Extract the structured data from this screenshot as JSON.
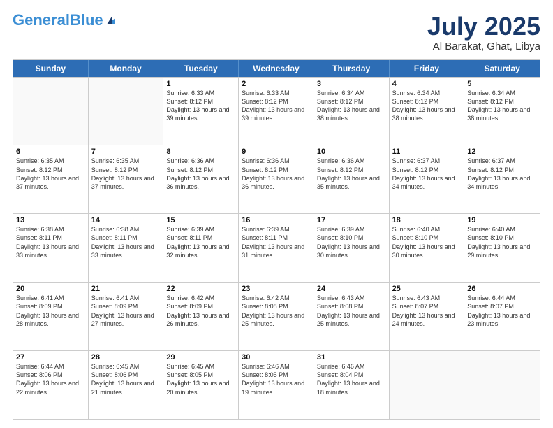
{
  "logo": {
    "part1": "General",
    "part2": "Blue"
  },
  "header": {
    "month": "July 2025",
    "location": "Al Barakat, Ghat, Libya"
  },
  "weekdays": [
    "Sunday",
    "Monday",
    "Tuesday",
    "Wednesday",
    "Thursday",
    "Friday",
    "Saturday"
  ],
  "weeks": [
    [
      {
        "day": "",
        "info": ""
      },
      {
        "day": "",
        "info": ""
      },
      {
        "day": "1",
        "info": "Sunrise: 6:33 AM\nSunset: 8:12 PM\nDaylight: 13 hours and 39 minutes."
      },
      {
        "day": "2",
        "info": "Sunrise: 6:33 AM\nSunset: 8:12 PM\nDaylight: 13 hours and 39 minutes."
      },
      {
        "day": "3",
        "info": "Sunrise: 6:34 AM\nSunset: 8:12 PM\nDaylight: 13 hours and 38 minutes."
      },
      {
        "day": "4",
        "info": "Sunrise: 6:34 AM\nSunset: 8:12 PM\nDaylight: 13 hours and 38 minutes."
      },
      {
        "day": "5",
        "info": "Sunrise: 6:34 AM\nSunset: 8:12 PM\nDaylight: 13 hours and 38 minutes."
      }
    ],
    [
      {
        "day": "6",
        "info": "Sunrise: 6:35 AM\nSunset: 8:12 PM\nDaylight: 13 hours and 37 minutes."
      },
      {
        "day": "7",
        "info": "Sunrise: 6:35 AM\nSunset: 8:12 PM\nDaylight: 13 hours and 37 minutes."
      },
      {
        "day": "8",
        "info": "Sunrise: 6:36 AM\nSunset: 8:12 PM\nDaylight: 13 hours and 36 minutes."
      },
      {
        "day": "9",
        "info": "Sunrise: 6:36 AM\nSunset: 8:12 PM\nDaylight: 13 hours and 36 minutes."
      },
      {
        "day": "10",
        "info": "Sunrise: 6:36 AM\nSunset: 8:12 PM\nDaylight: 13 hours and 35 minutes."
      },
      {
        "day": "11",
        "info": "Sunrise: 6:37 AM\nSunset: 8:12 PM\nDaylight: 13 hours and 34 minutes."
      },
      {
        "day": "12",
        "info": "Sunrise: 6:37 AM\nSunset: 8:12 PM\nDaylight: 13 hours and 34 minutes."
      }
    ],
    [
      {
        "day": "13",
        "info": "Sunrise: 6:38 AM\nSunset: 8:11 PM\nDaylight: 13 hours and 33 minutes."
      },
      {
        "day": "14",
        "info": "Sunrise: 6:38 AM\nSunset: 8:11 PM\nDaylight: 13 hours and 33 minutes."
      },
      {
        "day": "15",
        "info": "Sunrise: 6:39 AM\nSunset: 8:11 PM\nDaylight: 13 hours and 32 minutes."
      },
      {
        "day": "16",
        "info": "Sunrise: 6:39 AM\nSunset: 8:11 PM\nDaylight: 13 hours and 31 minutes."
      },
      {
        "day": "17",
        "info": "Sunrise: 6:39 AM\nSunset: 8:10 PM\nDaylight: 13 hours and 30 minutes."
      },
      {
        "day": "18",
        "info": "Sunrise: 6:40 AM\nSunset: 8:10 PM\nDaylight: 13 hours and 30 minutes."
      },
      {
        "day": "19",
        "info": "Sunrise: 6:40 AM\nSunset: 8:10 PM\nDaylight: 13 hours and 29 minutes."
      }
    ],
    [
      {
        "day": "20",
        "info": "Sunrise: 6:41 AM\nSunset: 8:09 PM\nDaylight: 13 hours and 28 minutes."
      },
      {
        "day": "21",
        "info": "Sunrise: 6:41 AM\nSunset: 8:09 PM\nDaylight: 13 hours and 27 minutes."
      },
      {
        "day": "22",
        "info": "Sunrise: 6:42 AM\nSunset: 8:09 PM\nDaylight: 13 hours and 26 minutes."
      },
      {
        "day": "23",
        "info": "Sunrise: 6:42 AM\nSunset: 8:08 PM\nDaylight: 13 hours and 25 minutes."
      },
      {
        "day": "24",
        "info": "Sunrise: 6:43 AM\nSunset: 8:08 PM\nDaylight: 13 hours and 25 minutes."
      },
      {
        "day": "25",
        "info": "Sunrise: 6:43 AM\nSunset: 8:07 PM\nDaylight: 13 hours and 24 minutes."
      },
      {
        "day": "26",
        "info": "Sunrise: 6:44 AM\nSunset: 8:07 PM\nDaylight: 13 hours and 23 minutes."
      }
    ],
    [
      {
        "day": "27",
        "info": "Sunrise: 6:44 AM\nSunset: 8:06 PM\nDaylight: 13 hours and 22 minutes."
      },
      {
        "day": "28",
        "info": "Sunrise: 6:45 AM\nSunset: 8:06 PM\nDaylight: 13 hours and 21 minutes."
      },
      {
        "day": "29",
        "info": "Sunrise: 6:45 AM\nSunset: 8:05 PM\nDaylight: 13 hours and 20 minutes."
      },
      {
        "day": "30",
        "info": "Sunrise: 6:46 AM\nSunset: 8:05 PM\nDaylight: 13 hours and 19 minutes."
      },
      {
        "day": "31",
        "info": "Sunrise: 6:46 AM\nSunset: 8:04 PM\nDaylight: 13 hours and 18 minutes."
      },
      {
        "day": "",
        "info": ""
      },
      {
        "day": "",
        "info": ""
      }
    ]
  ]
}
